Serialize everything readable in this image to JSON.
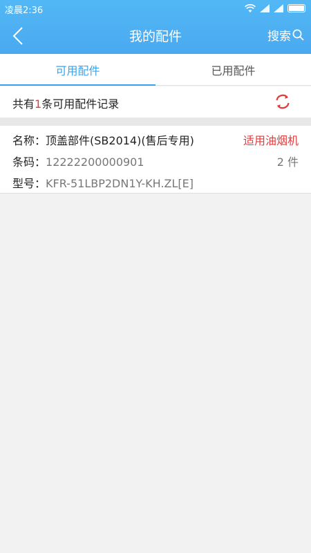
{
  "status_bar": {
    "time": "凌晨2:36"
  },
  "header": {
    "title": "我的配件",
    "search_label": "搜索"
  },
  "tabs": [
    {
      "label": "可用配件",
      "active": true
    },
    {
      "label": "已用配件",
      "active": false
    }
  ],
  "summary": {
    "prefix": "共有",
    "count": "1",
    "suffix": "条可用配件记录"
  },
  "parts": [
    {
      "name_label": "名称：",
      "name": "顶盖部件(SB2014)(售后专用)",
      "tag": "适用油烟机",
      "code_label": "条码：",
      "code": "12222200000901",
      "quantity": "2 件",
      "model_label": "型号：",
      "model": "KFR-51LBP2DN1Y-KH.ZL[E]"
    }
  ],
  "colors": {
    "header": "#4aa9f0",
    "accent": "#3aa2ea",
    "highlight": "#e03b3b"
  }
}
